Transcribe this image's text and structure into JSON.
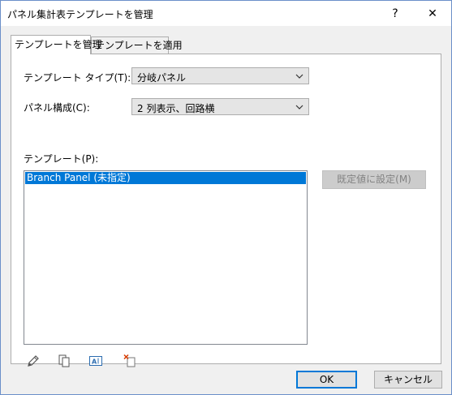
{
  "window": {
    "title": "パネル集計表テンプレートを管理",
    "help_label": "?",
    "close_label": "✕"
  },
  "tabs": [
    {
      "label": "テンプレートを管理",
      "active": true
    },
    {
      "label": "テンプレートを適用",
      "active": false
    }
  ],
  "fields": {
    "template_type": {
      "label": "テンプレート タイプ(T):",
      "value": "分岐パネル"
    },
    "panel_config": {
      "label": "パネル構成(C):",
      "value": "2 列表示、回路横"
    },
    "templates_label": "テンプレート(P):"
  },
  "template_list": {
    "items": [
      "Branch Panel (未指定)"
    ],
    "selected_index": 0
  },
  "set_default_button": "既定値に設定(M)",
  "toolbar_icons": [
    "pencil-icon",
    "duplicate-icon",
    "rename-icon",
    "delete-icon"
  ],
  "footer": {
    "ok_label": "OK",
    "cancel_label": "キャンセル"
  },
  "colors": {
    "selection": "#0078d7",
    "default_button_border": "#0078d7"
  }
}
